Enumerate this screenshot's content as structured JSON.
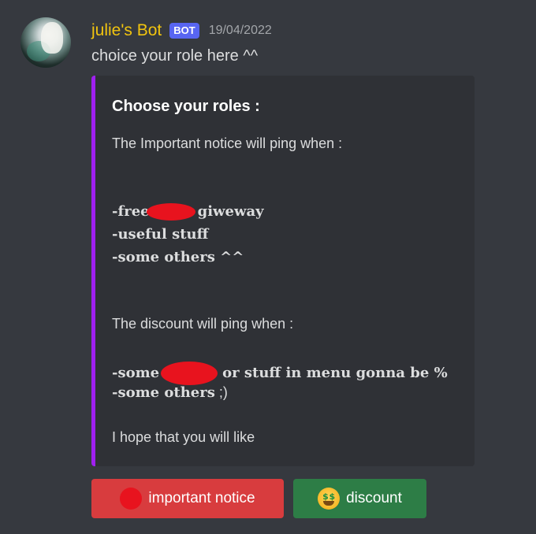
{
  "message": {
    "author": "julie's Bot",
    "bot_tag": "BOT",
    "timestamp": "19/04/2022",
    "content": "choice your role here ^^",
    "author_color": "#f1c40f"
  },
  "embed": {
    "accent_color": "#a020f0",
    "title": "Choose your roles :",
    "important_intro": "The Important notice will ping when :",
    "important_item_1_prefix": "-free",
    "important_item_1_suffix": "giweway",
    "important_item_2": "-useful stuff",
    "important_item_3": "-some others ^^",
    "discount_intro": "The discount will ping when :",
    "discount_item_1_prefix": "-some",
    "discount_item_1_suffix": "or stuff in menu gonna be %",
    "discount_item_2_serif": "-some others",
    "discount_item_2_tail": ";)",
    "closing": "I hope that you will like"
  },
  "buttons": [
    {
      "label": "important notice",
      "emoji": "red-circle-icon",
      "color": "#d83c3e"
    },
    {
      "label": "discount",
      "emoji": "money-mouth-face-icon",
      "color": "#2d7d46"
    }
  ]
}
